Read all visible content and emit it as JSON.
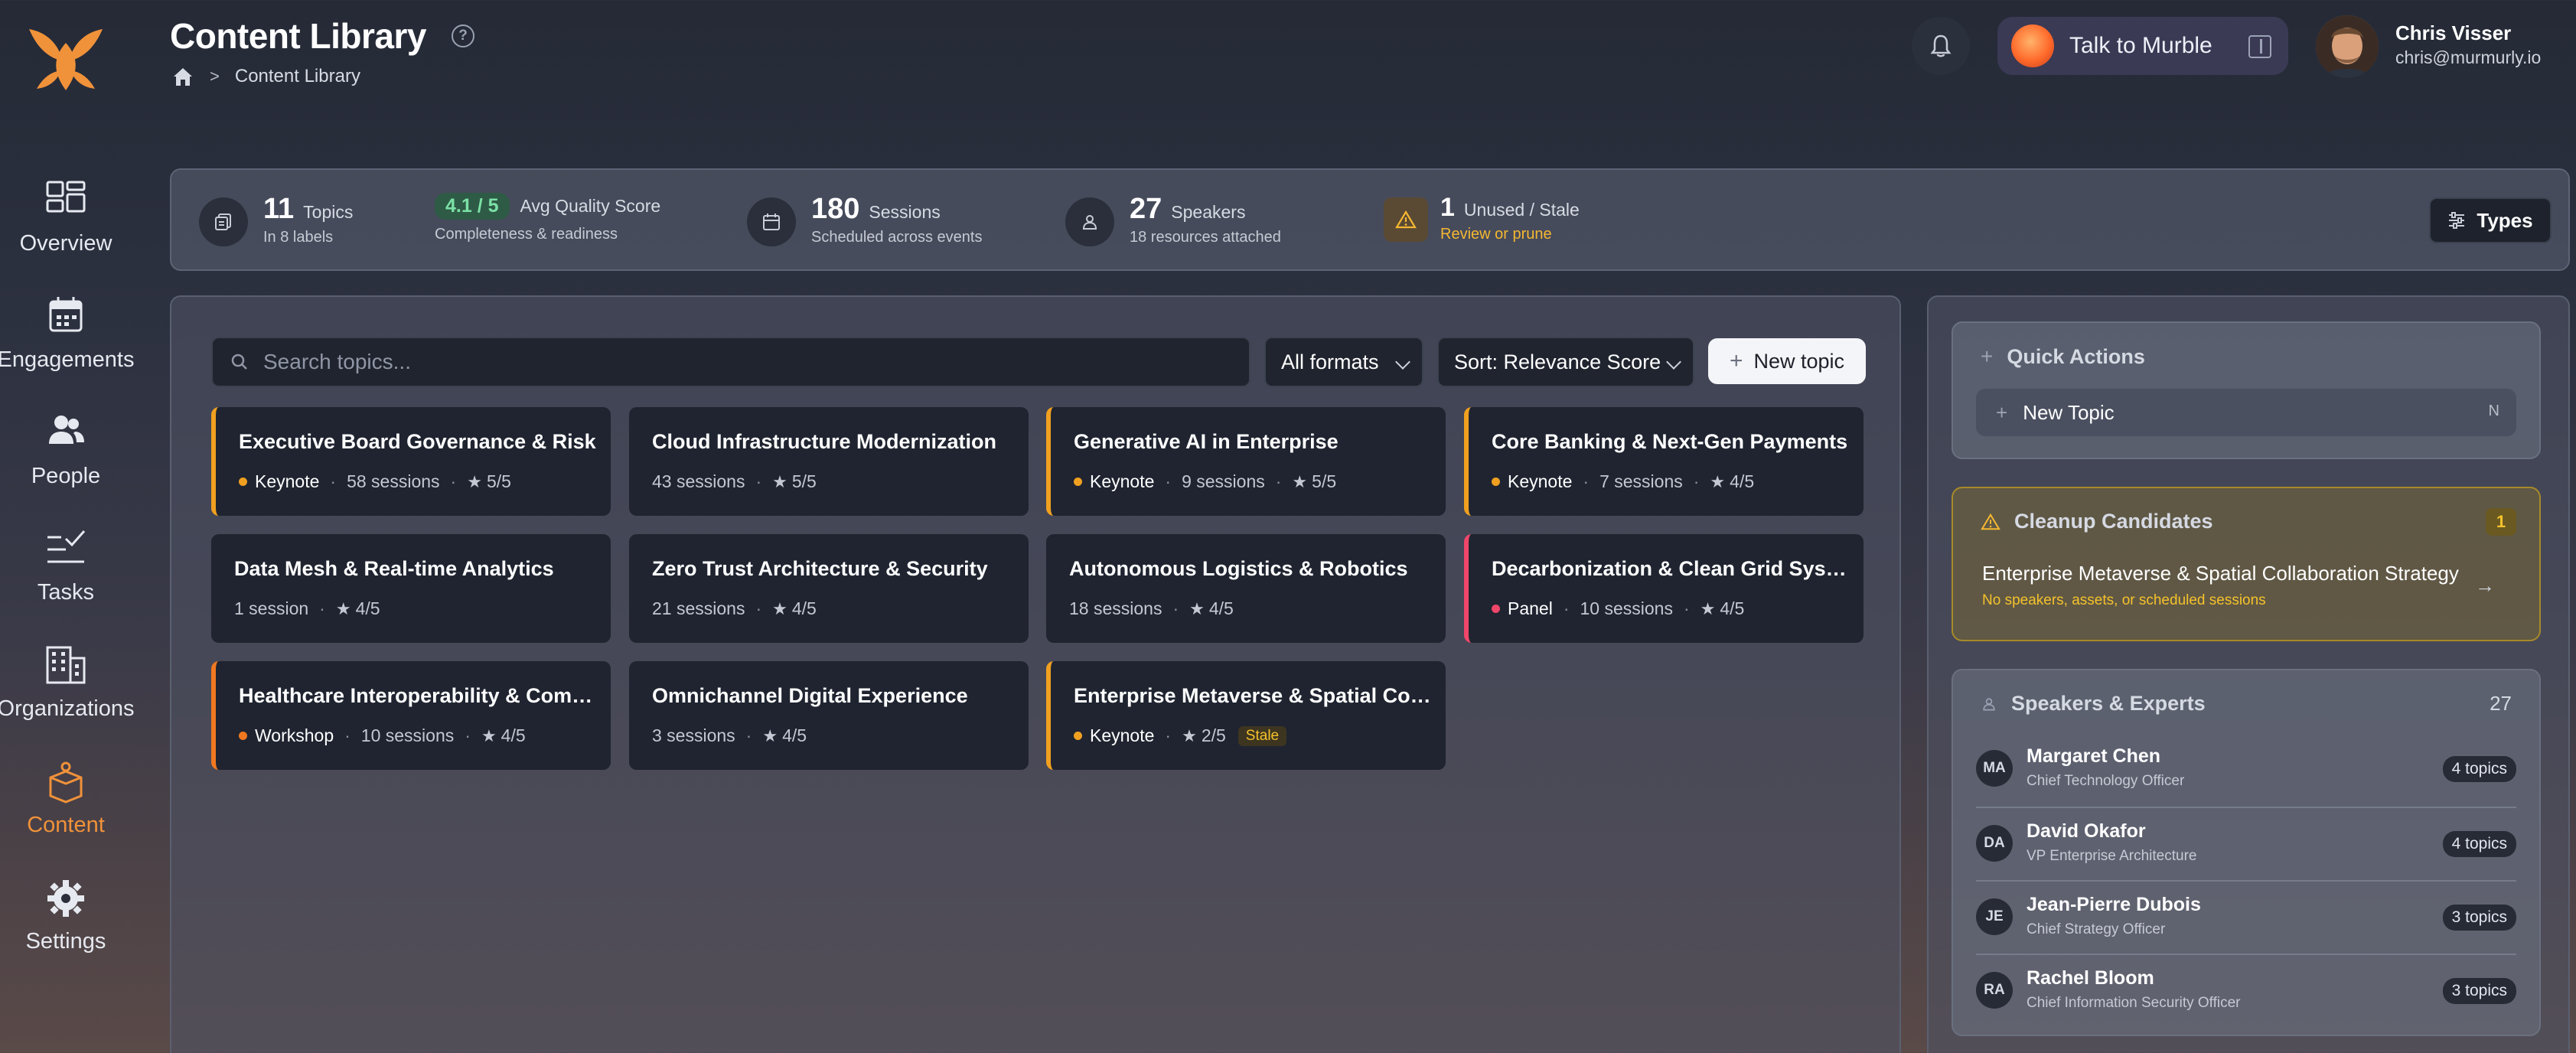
{
  "sidebar": {
    "items": [
      {
        "label": "Overview",
        "icon": "grid-icon"
      },
      {
        "label": "Engagements",
        "icon": "calendar-icon"
      },
      {
        "label": "People",
        "icon": "people-icon"
      },
      {
        "label": "Tasks",
        "icon": "checklist-icon"
      },
      {
        "label": "Organizations",
        "icon": "building-icon"
      },
      {
        "label": "Content",
        "icon": "box-icon",
        "active": true
      },
      {
        "label": "Settings",
        "icon": "gear-icon"
      }
    ]
  },
  "header": {
    "title": "Content Library",
    "help": "?",
    "breadcrumb": {
      "current": "Content Library",
      "separator": ">"
    },
    "assistant_label": "Talk to Murble",
    "user": {
      "name": "Chris Visser",
      "email": "chris@murmurly.io"
    }
  },
  "stats": {
    "topics": {
      "value": "11",
      "unit": "Topics",
      "sub": "In 8 labels"
    },
    "quality": {
      "value": "4.1 / 5",
      "label": "Avg Quality Score",
      "sub": "Completeness & readiness"
    },
    "sessions": {
      "value": "180",
      "unit": "Sessions",
      "sub": "Scheduled across events"
    },
    "speakers": {
      "value": "27",
      "unit": "Speakers",
      "sub": "18 resources attached"
    },
    "unused": {
      "value": "1",
      "unit": "Unused / Stale",
      "sub": "Review or prune"
    },
    "types_label": "Types"
  },
  "toolbar": {
    "search_placeholder": "Search topics...",
    "format_filter": "All formats",
    "sort": "Sort: Relevance Score",
    "new_topic": "New topic"
  },
  "topics": [
    {
      "title": "Executive Board Governance & Risk",
      "format": "Keynote",
      "sessions": "58 sessions",
      "score": "5/5",
      "accent": "#f0a020"
    },
    {
      "title": "Cloud Infrastructure Modernization",
      "format": "",
      "sessions": "43 sessions",
      "score": "5/5",
      "accent": ""
    },
    {
      "title": "Generative AI in Enterprise",
      "format": "Keynote",
      "sessions": "9 sessions",
      "score": "5/5",
      "accent": "#f0a020"
    },
    {
      "title": "Core Banking & Next-Gen Payments",
      "format": "Keynote",
      "sessions": "7 sessions",
      "score": "4/5",
      "accent": "#f0a020"
    },
    {
      "title": "Data Mesh & Real-time Analytics",
      "format": "",
      "sessions": "1 session",
      "score": "4/5",
      "accent": ""
    },
    {
      "title": "Zero Trust Architecture & Security",
      "format": "",
      "sessions": "21 sessions",
      "score": "4/5",
      "accent": ""
    },
    {
      "title": "Autonomous Logistics & Robotics",
      "format": "",
      "sessions": "18 sessions",
      "score": "4/5",
      "accent": ""
    },
    {
      "title": "Decarbonization & Clean Grid Syste...",
      "format": "Panel",
      "sessions": "10 sessions",
      "score": "4/5",
      "accent": "#f0466a"
    },
    {
      "title": "Healthcare Interoperability & Compli...",
      "format": "Workshop",
      "sessions": "10 sessions",
      "score": "4/5",
      "accent": "#f07820"
    },
    {
      "title": "Omnichannel Digital Experience",
      "format": "",
      "sessions": "3 sessions",
      "score": "4/5",
      "accent": ""
    },
    {
      "title": "Enterprise Metaverse & Spatial Colla...",
      "format": "Keynote",
      "sessions": "",
      "score": "2/5",
      "accent": "#f0a020",
      "badge": "Stale"
    }
  ],
  "quick_actions": {
    "title": "Quick Actions",
    "item": "New Topic",
    "shortcut": "N"
  },
  "cleanup": {
    "title": "Cleanup Candidates",
    "count": "1",
    "item_title": "Enterprise Metaverse & Spatial Collaboration Strategy",
    "item_sub": "No speakers, assets, or scheduled sessions"
  },
  "speakers": {
    "title": "Speakers & Experts",
    "count": "27",
    "list": [
      {
        "initials": "MA",
        "name": "Margaret Chen",
        "role": "Chief Technology Officer",
        "topics": "4 topics"
      },
      {
        "initials": "DA",
        "name": "David Okafor",
        "role": "VP Enterprise Architecture",
        "topics": "4 topics"
      },
      {
        "initials": "JE",
        "name": "Jean-Pierre Dubois",
        "role": "Chief Strategy Officer",
        "topics": "3 topics"
      },
      {
        "initials": "RA",
        "name": "Rachel Bloom",
        "role": "Chief Information Security Officer",
        "topics": "3 topics"
      }
    ]
  },
  "colors": {
    "accent": "#f0923a",
    "success": "#7be0a6",
    "warning": "#f5c22b",
    "danger": "#f0466a"
  }
}
